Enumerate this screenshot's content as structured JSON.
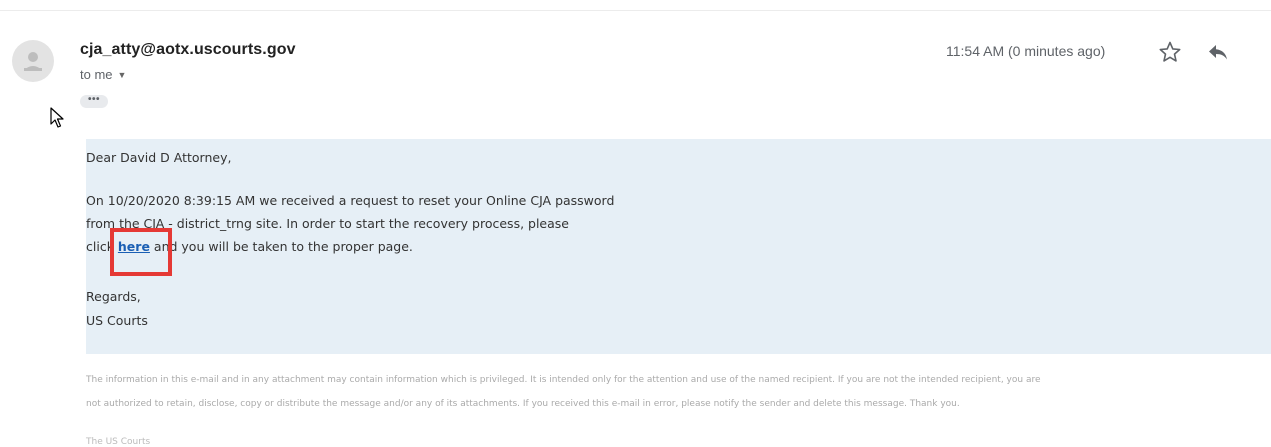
{
  "email": {
    "sender": "cja_atty@aotx.uscourts.gov",
    "recipient_label": "to me",
    "ellipsis": "•••",
    "timestamp": "11:54 AM (0 minutes ago)"
  },
  "message": {
    "greeting": "Dear David D Attorney,",
    "para_line1": "On 10/20/2020 8:39:15 AM we received a request to reset your Online CJA password",
    "para_line2": "from the CJA - district_trng site. In order to start the recovery process, please",
    "para_line3_before": "click ",
    "link_text": "here",
    "para_line3_after": " and you will be taken to the proper page.",
    "regards": "Regards,",
    "signature": "US Courts"
  },
  "disclaimer": {
    "line1": "The information in this e-mail and in any attachment may contain information which is privileged. It is intended only for the attention and use of the named recipient. If you are not the intended recipient, you are",
    "line2": "not authorized to retain, disclose, copy or distribute the message and/or any of its attachments. If you received this e-mail in error, please notify the sender and delete this message. Thank you.",
    "signoff": "The US Courts"
  },
  "icons": {
    "avatar": "person-icon",
    "star": "star-outline-icon",
    "reply": "reply-icon",
    "cursor": "mouse-pointer-icon"
  },
  "colors": {
    "body_background": "#e6eff6",
    "highlight_border": "#e53935",
    "link": "#1a5fb4"
  }
}
